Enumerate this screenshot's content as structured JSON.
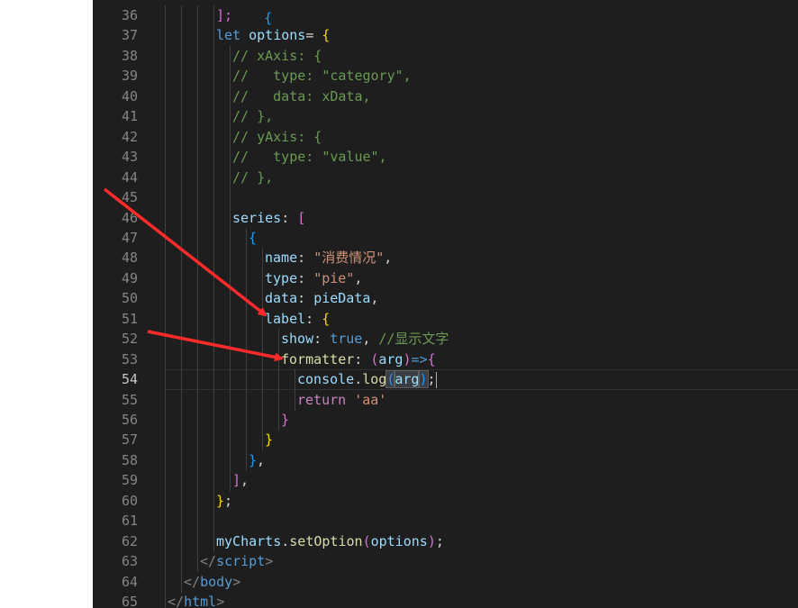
{
  "lines": [
    {
      "n": "36",
      "tokens": [
        [
          "p2",
          "];"
        ]
      ]
    },
    {
      "n": "37",
      "tokens": [
        [
          "k1",
          "let "
        ],
        [
          "v",
          "options"
        ],
        [
          "",
          "="
        ],
        [
          "p1",
          " {"
        ]
      ]
    },
    {
      "n": "38",
      "tokens": [
        [
          "c",
          "// xAxis: {"
        ]
      ]
    },
    {
      "n": "39",
      "tokens": [
        [
          "c",
          "//   type: \"category\","
        ]
      ]
    },
    {
      "n": "40",
      "tokens": [
        [
          "c",
          "//   data: xData,"
        ]
      ]
    },
    {
      "n": "41",
      "tokens": [
        [
          "c",
          "// },"
        ]
      ]
    },
    {
      "n": "42",
      "tokens": [
        [
          "c",
          "// yAxis: {"
        ]
      ]
    },
    {
      "n": "43",
      "tokens": [
        [
          "c",
          "//   type: \"value\","
        ]
      ]
    },
    {
      "n": "44",
      "tokens": [
        [
          "c",
          "// },"
        ]
      ]
    },
    {
      "n": "45",
      "tokens": []
    },
    {
      "n": "46",
      "tokens": [
        [
          "v",
          "series"
        ],
        [
          "",
          ": "
        ],
        [
          "p2",
          "["
        ]
      ]
    },
    {
      "n": "47",
      "tokens": [
        [
          "p3",
          "{"
        ]
      ]
    },
    {
      "n": "48",
      "tokens": [
        [
          "v",
          "name"
        ],
        [
          "",
          ": "
        ],
        [
          "s",
          "\"消费情况\""
        ],
        [
          "",
          ","
        ]
      ]
    },
    {
      "n": "49",
      "tokens": [
        [
          "v",
          "type"
        ],
        [
          "",
          ": "
        ],
        [
          "s",
          "\"pie\""
        ],
        [
          "",
          ","
        ]
      ]
    },
    {
      "n": "50",
      "tokens": [
        [
          "v",
          "data"
        ],
        [
          "",
          ": "
        ],
        [
          "v",
          "pieData"
        ],
        [
          "",
          ","
        ]
      ]
    },
    {
      "n": "51",
      "tokens": [
        [
          "v",
          "label"
        ],
        [
          "",
          ": "
        ],
        [
          "p1",
          "{"
        ]
      ]
    },
    {
      "n": "52",
      "tokens": [
        [
          "v",
          "show"
        ],
        [
          "",
          ": "
        ],
        [
          "k1",
          "true"
        ],
        [
          "",
          ", "
        ],
        [
          "c",
          "//显示文字"
        ]
      ]
    },
    {
      "n": "53",
      "tokens": [
        [
          "f",
          "formatter"
        ],
        [
          "",
          ": "
        ],
        [
          "p2",
          "("
        ],
        [
          "v",
          "arg"
        ],
        [
          "p2",
          ")"
        ],
        [
          "k1",
          "=>"
        ],
        [
          "p2",
          "{"
        ]
      ]
    },
    {
      "n": "54",
      "tokens": [
        [
          "v",
          "console"
        ],
        [
          "",
          "."
        ],
        [
          "f",
          "log"
        ],
        [
          "p3",
          "("
        ],
        [
          "v",
          "arg"
        ],
        [
          "p3",
          ")"
        ],
        [
          "",
          ";"
        ]
      ]
    },
    {
      "n": "55",
      "tokens": [
        [
          "kw",
          "return "
        ],
        [
          "s",
          "'aa'"
        ]
      ]
    },
    {
      "n": "56",
      "tokens": [
        [
          "p2",
          "}"
        ]
      ]
    },
    {
      "n": "57",
      "tokens": [
        [
          "p1",
          "}"
        ]
      ]
    },
    {
      "n": "58",
      "tokens": [
        [
          "p3",
          "}"
        ],
        [
          "",
          ","
        ]
      ]
    },
    {
      "n": "59",
      "tokens": [
        [
          "p2",
          "]"
        ],
        [
          "",
          ","
        ]
      ]
    },
    {
      "n": "60",
      "tokens": [
        [
          "p1",
          "}"
        ],
        [
          "",
          ";"
        ]
      ]
    },
    {
      "n": "61",
      "tokens": []
    },
    {
      "n": "62",
      "tokens": [
        [
          "v",
          "myCharts"
        ],
        [
          "",
          "."
        ],
        [
          "f",
          "setOption"
        ],
        [
          "p2",
          "("
        ],
        [
          "v",
          "options"
        ],
        [
          "p2",
          ")"
        ],
        [
          "",
          ";"
        ]
      ]
    },
    {
      "n": "63",
      "tokens": [
        [
          "pun",
          "</"
        ],
        [
          "tag",
          "script"
        ],
        [
          "pun",
          ">"
        ]
      ]
    },
    {
      "n": "64",
      "tokens": [
        [
          "pun",
          "</"
        ],
        [
          "tag",
          "body"
        ],
        [
          "pun",
          ">"
        ]
      ]
    },
    {
      "n": "65",
      "tokens": [
        [
          "pun",
          "</"
        ],
        [
          "tag",
          "html"
        ],
        [
          "pun",
          ">"
        ]
      ]
    }
  ],
  "active_line": "54",
  "colors": {
    "background": "#1e1e1e",
    "arrow": "#ff2a2a"
  }
}
